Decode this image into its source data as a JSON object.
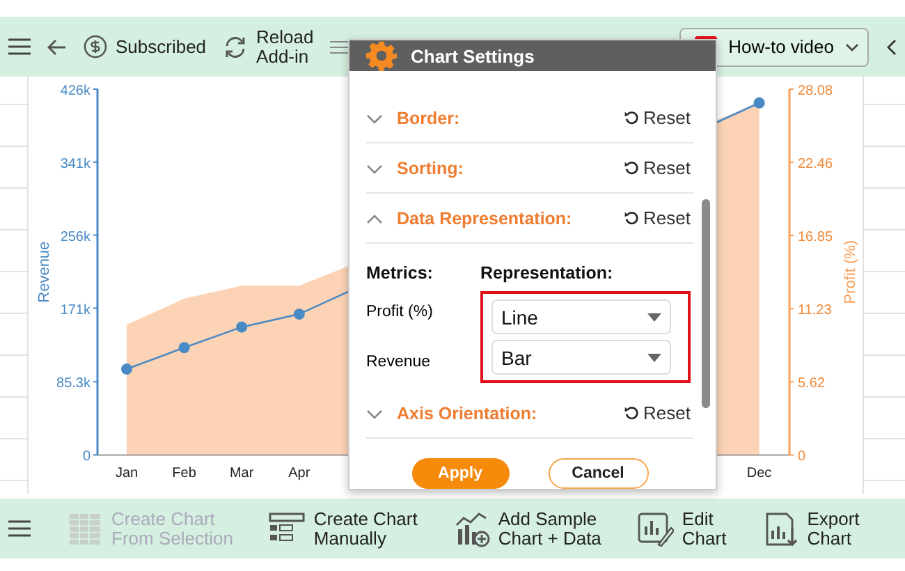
{
  "toolbar": {
    "subscribed": "Subscribed",
    "reload": [
      "Reload",
      "Add-in"
    ],
    "video": "How-to video"
  },
  "chart": {
    "chart_data": {
      "type": "line",
      "categories": [
        "Jan",
        "Feb",
        "Mar",
        "Apr",
        null,
        null,
        null,
        null,
        null,
        null,
        null,
        "Dec"
      ],
      "ylim": [
        0,
        426000
      ],
      "yticks": [
        {
          "value": 0,
          "label": "0"
        },
        {
          "value": 85300,
          "label": "85.3k"
        },
        {
          "value": 171000,
          "label": "171k"
        },
        {
          "value": 256000,
          "label": "256k"
        },
        {
          "value": 341000,
          "label": "341k"
        },
        {
          "value": 426000,
          "label": "426k"
        }
      ],
      "series": [
        {
          "name": "Revenue",
          "color": "#4a8ac4",
          "marker": "circle",
          "values": [
            100000,
            125000,
            149000,
            164000,
            null,
            null,
            null,
            null,
            null,
            null,
            null,
            410000
          ]
        },
        {
          "name": "Profit (%)",
          "color": "#f8a05a",
          "axis": "y2",
          "type": "area",
          "values": [
            10,
            12,
            13,
            13,
            null,
            null,
            null,
            null,
            null,
            null,
            null,
            27
          ]
        }
      ],
      "y2lim": [
        0,
        28.08
      ],
      "y2ticks": [
        {
          "value": 0,
          "label": "0"
        },
        {
          "value": 5.62,
          "label": "5.62"
        },
        {
          "value": 11.23,
          "label": "11.23"
        },
        {
          "value": 16.85,
          "label": "16.85"
        },
        {
          "value": 22.46,
          "label": "22.46"
        },
        {
          "value": 28.08,
          "label": "28.08"
        }
      ]
    }
  },
  "dialog": {
    "title": "Chart Settings",
    "sections": [
      {
        "label": "Border:",
        "expanded": false,
        "reset": "Reset"
      },
      {
        "label": "Sorting:",
        "expanded": false,
        "reset": "Reset"
      },
      {
        "label": "Data Representation:",
        "expanded": true,
        "reset": "Reset"
      }
    ],
    "metrics_header": "Metrics:",
    "representation_header": "Representation:",
    "metrics": [
      {
        "name": "Profit (%)",
        "value": "Line"
      },
      {
        "name": "Revenue",
        "value": "Bar"
      }
    ],
    "after": [
      {
        "label": "Axis Orientation:",
        "expanded": false,
        "reset": "Reset"
      }
    ],
    "apply": "Apply",
    "cancel": "Cancel"
  },
  "bottom_toolbar": [
    {
      "lines": [
        "Create Chart",
        "From Selection"
      ],
      "disabled": true,
      "kind": "grid"
    },
    {
      "lines": [
        "Create Chart",
        "Manually"
      ],
      "disabled": false,
      "kind": "form"
    },
    {
      "lines": [
        "Add Sample",
        "Chart + Data"
      ],
      "disabled": false,
      "kind": "sample"
    },
    {
      "lines": [
        "Edit",
        "Chart"
      ],
      "disabled": false,
      "kind": "edit"
    },
    {
      "lines": [
        "Export",
        "Chart"
      ],
      "disabled": false,
      "kind": "export"
    }
  ]
}
